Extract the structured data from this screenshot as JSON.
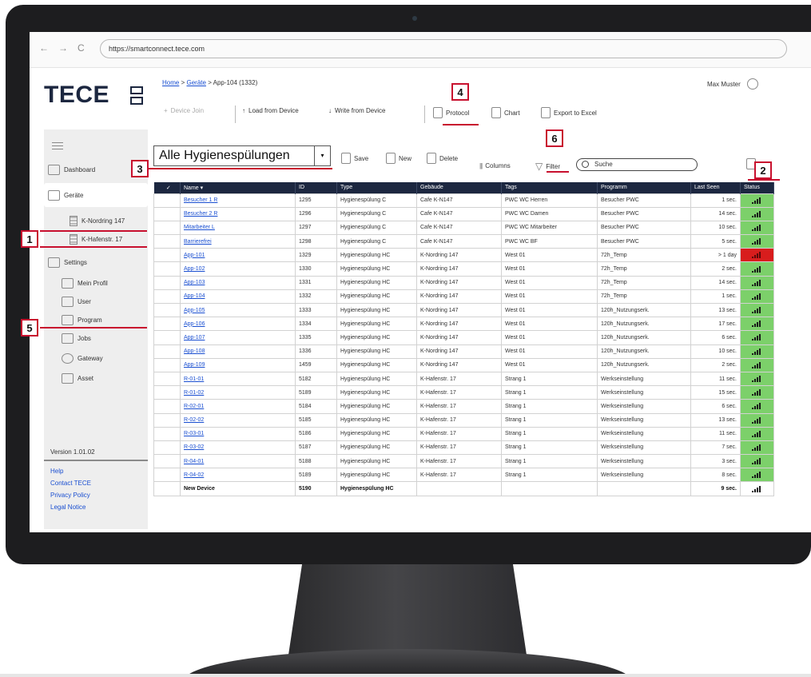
{
  "browser": {
    "url": "https://smartconnect.tece.com",
    "back_icon": "←",
    "forward_icon": "→",
    "reload_icon": "C"
  },
  "brand": {
    "logo_text": "TECE"
  },
  "sidebar": {
    "dashboard": "Dashboard",
    "devices": "Geräte",
    "devices_sub": [
      "K-Nordring 147",
      "K-Hafenstr. 17"
    ],
    "settings": "Settings",
    "settings_sub": [
      "Mein Profil",
      "User",
      "Program",
      "Jobs",
      "Gateway",
      "Asset"
    ],
    "version": "Version 1.01.02",
    "links": [
      "Help",
      "Contact TECE",
      "Privacy Policy",
      "Legal Notice"
    ]
  },
  "header": {
    "crumb_home": "Home",
    "crumb_sep1": ">",
    "crumb_devices": "Geräte",
    "crumb_sep2": ">",
    "crumb_current": "App-104 (1332)",
    "user_name": "Max Muster"
  },
  "toolbar": {
    "device_join": "Device Join",
    "load": "Load from Device",
    "write": "Write from Device",
    "protocol": "Protocol",
    "chart": "Chart",
    "export": "Export to Excel"
  },
  "viewbar": {
    "view_name": "Alle Hygienespülungen",
    "save": "Save",
    "new": "New",
    "delete": "Delete",
    "columns": "Columns",
    "filter": "Filter",
    "search_placeholder": "Suche"
  },
  "table": {
    "columns": [
      "Name ▾",
      "ID",
      "Type",
      "Gebäude",
      "Tags",
      "Programm",
      "Last Seen",
      "Status"
    ],
    "rows": [
      {
        "name": "Besucher 1 R",
        "id": "1295",
        "type": "Hygienespülung C",
        "building": "Cafe K-N147",
        "tags": "PWC WC Herren",
        "program": "Besucher PWC",
        "last_seen": "1 sec.",
        "status": "ok"
      },
      {
        "name": "Besucher 2 R",
        "id": "1296",
        "type": "Hygienespülung C",
        "building": "Cafe K-N147",
        "tags": "PWC WC Damen",
        "program": "Besucher PWC",
        "last_seen": "14 sec.",
        "status": "ok"
      },
      {
        "name": "Mitarbeiter L",
        "id": "1297",
        "type": "Hygienespülung C",
        "building": "Cafe K-N147",
        "tags": "PWC WC Mitarbeiter",
        "program": "Besucher PWC",
        "last_seen": "10 sec.",
        "status": "ok"
      },
      {
        "name": "Barrierefrei",
        "id": "1298",
        "type": "Hygienespülung C",
        "building": "Cafe K-N147",
        "tags": "PWC WC BF",
        "program": "Besucher PWC",
        "last_seen": "5 sec.",
        "status": "ok"
      },
      {
        "name": "App-101",
        "id": "1329",
        "type": "Hygienespülung HC",
        "building": "K-Nordring 147",
        "tags": "West 01",
        "program": "72h_Temp",
        "last_seen": "> 1 day",
        "status": "bad"
      },
      {
        "name": "App-102",
        "id": "1330",
        "type": "Hygienespülung HC",
        "building": "K-Nordring 147",
        "tags": "West 01",
        "program": "72h_Temp",
        "last_seen": "2 sec.",
        "status": "ok"
      },
      {
        "name": "App-103",
        "id": "1331",
        "type": "Hygienespülung HC",
        "building": "K-Nordring 147",
        "tags": "West 01",
        "program": "72h_Temp",
        "last_seen": "14 sec.",
        "status": "ok"
      },
      {
        "name": "App-104",
        "id": "1332",
        "type": "Hygienespülung HC",
        "building": "K-Nordring 147",
        "tags": "West 01",
        "program": "72h_Temp",
        "last_seen": "1 sec.",
        "status": "ok"
      },
      {
        "name": "App-105",
        "id": "1333",
        "type": "Hygienespülung HC",
        "building": "K-Nordring 147",
        "tags": "West 01",
        "program": "120h_Nutzungserk.",
        "last_seen": "13 sec.",
        "status": "ok"
      },
      {
        "name": "App-106",
        "id": "1334",
        "type": "Hygienespülung HC",
        "building": "K-Nordring 147",
        "tags": "West 01",
        "program": "120h_Nutzungserk.",
        "last_seen": "17 sec.",
        "status": "ok"
      },
      {
        "name": "App-107",
        "id": "1335",
        "type": "Hygienespülung HC",
        "building": "K-Nordring 147",
        "tags": "West 01",
        "program": "120h_Nutzungserk.",
        "last_seen": "6 sec.",
        "status": "ok"
      },
      {
        "name": "App-108",
        "id": "1336",
        "type": "Hygienespülung HC",
        "building": "K-Nordring 147",
        "tags": "West 01",
        "program": "120h_Nutzungserk.",
        "last_seen": "10 sec.",
        "status": "ok"
      },
      {
        "name": "App-109",
        "id": "1459",
        "type": "Hygienespülung HC",
        "building": "K-Nordring 147",
        "tags": "West 01",
        "program": "120h_Nutzungserk.",
        "last_seen": "2 sec.",
        "status": "ok"
      },
      {
        "name": "R-01-01",
        "id": "5182",
        "type": "Hygienespülung HC",
        "building": "K-Hafenstr. 17",
        "tags": "Strang 1",
        "program": "Werkseinstellung",
        "last_seen": "11 sec.",
        "status": "ok"
      },
      {
        "name": "R-01-02",
        "id": "5189",
        "type": "Hygienespülung HC",
        "building": "K-Hafenstr. 17",
        "tags": "Strang 1",
        "program": "Werkseinstellung",
        "last_seen": "15 sec.",
        "status": "ok"
      },
      {
        "name": "R-02-01",
        "id": "5184",
        "type": "Hygienespülung HC",
        "building": "K-Hafenstr. 17",
        "tags": "Strang 1",
        "program": "Werkseinstellung",
        "last_seen": "6 sec.",
        "status": "ok"
      },
      {
        "name": "R-02-02",
        "id": "5185",
        "type": "Hygienespülung HC",
        "building": "K-Hafenstr. 17",
        "tags": "Strang 1",
        "program": "Werkseinstellung",
        "last_seen": "13 sec.",
        "status": "ok"
      },
      {
        "name": "R-03-01",
        "id": "5186",
        "type": "Hygienespülung HC",
        "building": "K-Hafenstr. 17",
        "tags": "Strang 1",
        "program": "Werkseinstellung",
        "last_seen": "11 sec.",
        "status": "ok"
      },
      {
        "name": "R-03-02",
        "id": "5187",
        "type": "Hygienespülung HC",
        "building": "K-Hafenstr. 17",
        "tags": "Strang 1",
        "program": "Werkseinstellung",
        "last_seen": "7 sec.",
        "status": "ok"
      },
      {
        "name": "R-04-01",
        "id": "5188",
        "type": "Hygienespülung HC",
        "building": "K-Hafenstr. 17",
        "tags": "Strang 1",
        "program": "Werkseinstellung",
        "last_seen": "3 sec.",
        "status": "ok"
      },
      {
        "name": "R-04-02",
        "id": "5189",
        "type": "Hygienespülung HC",
        "building": "K-Hafenstr. 17",
        "tags": "Strang 1",
        "program": "Werkseinstellung",
        "last_seen": "8 sec.",
        "status": "ok"
      },
      {
        "name": "New Device",
        "id": "5190",
        "type": "Hygienespülung HC",
        "building": "",
        "tags": "",
        "program": "",
        "last_seen": "9 sec.",
        "status": "none"
      }
    ]
  },
  "callouts": [
    "1",
    "2",
    "3",
    "4",
    "5",
    "6"
  ],
  "colors": {
    "brand_navy": "#1c2740",
    "status_ok": "#7cd06a",
    "status_bad": "#d81d1d",
    "callout_red": "#c8102e",
    "link_blue": "#1a4fd1"
  }
}
